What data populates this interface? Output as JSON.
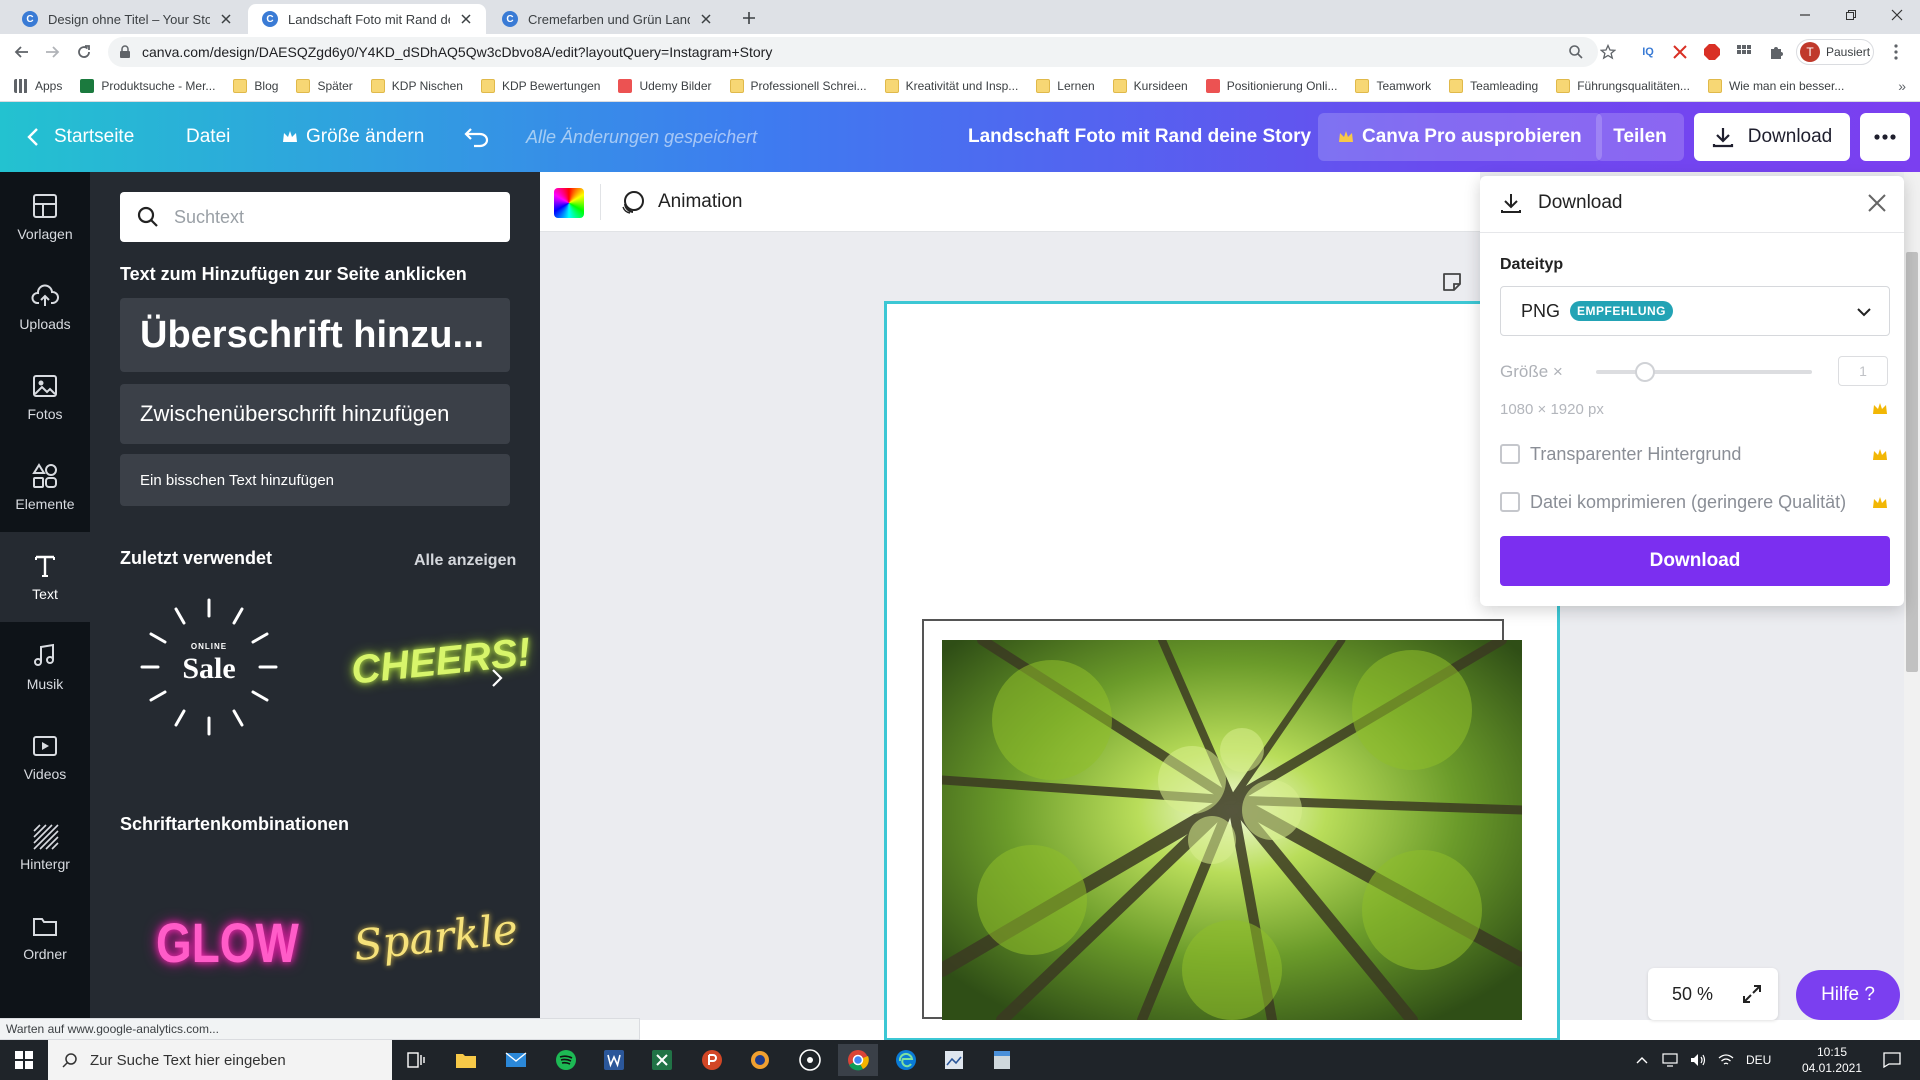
{
  "browser": {
    "tabs": [
      {
        "label": "Design ohne Titel – Your Story"
      },
      {
        "label": "Landschaft Foto mit Rand deine"
      },
      {
        "label": "Cremefarben und Grün Landkarte"
      }
    ],
    "url": "canva.com/design/DAESQZgd6y0/Y4KD_dSDhAQ5Qw3cDbvo8A/edit?layoutQuery=Instagram+Story",
    "profile_label": "Pausiert",
    "profile_initial": "T",
    "bookmarks": [
      {
        "label": "Apps",
        "icon": "apps-grid-icon"
      },
      {
        "label": "Produktsuche - Mer...",
        "icon": "merch-icon"
      },
      {
        "label": "Blog",
        "icon": "folder-icon"
      },
      {
        "label": "Später",
        "icon": "folder-icon"
      },
      {
        "label": "KDP Nischen",
        "icon": "folder-icon"
      },
      {
        "label": "KDP Bewertungen",
        "icon": "folder-icon"
      },
      {
        "label": "Udemy Bilder",
        "icon": "udemy-icon"
      },
      {
        "label": "Professionell Schrei...",
        "icon": "folder-icon"
      },
      {
        "label": "Kreativität und Insp...",
        "icon": "folder-icon"
      },
      {
        "label": "Lernen",
        "icon": "folder-icon"
      },
      {
        "label": "Kursideen",
        "icon": "folder-icon"
      },
      {
        "label": "Positionierung Onli...",
        "icon": "udemy-icon"
      },
      {
        "label": "Teamwork",
        "icon": "folder-icon"
      },
      {
        "label": "Teamleading",
        "icon": "folder-icon"
      },
      {
        "label": "Führungsqualitäten...",
        "icon": "folder-icon"
      },
      {
        "label": "Wie man ein besser...",
        "icon": "folder-icon"
      }
    ],
    "status_text": "Warten auf www.google-analytics.com..."
  },
  "header": {
    "home": "Startseite",
    "file": "Datei",
    "resize": "Größe ändern",
    "saved": "Alle Änderungen gespeichert",
    "title": "Landschaft Foto mit Rand deine Story",
    "pro": "Canva Pro ausprobieren",
    "share": "Teilen",
    "download": "Download"
  },
  "rail": [
    {
      "label": "Vorlagen",
      "icon": "templates-icon"
    },
    {
      "label": "Uploads",
      "icon": "upload-cloud-icon"
    },
    {
      "label": "Fotos",
      "icon": "photo-icon"
    },
    {
      "label": "Elemente",
      "icon": "elements-icon"
    },
    {
      "label": "Text",
      "icon": "text-icon"
    },
    {
      "label": "Musik",
      "icon": "music-icon"
    },
    {
      "label": "Videos",
      "icon": "video-icon"
    },
    {
      "label": "Hintergr",
      "icon": "background-icon"
    },
    {
      "label": "Ordner",
      "icon": "folder-icon"
    }
  ],
  "panel": {
    "search_placeholder": "Suchtext",
    "click_hint": "Text zum Hinzufügen zur Seite anklicken",
    "heading": "Überschrift hinzu...",
    "subheading": "Zwischenüberschrift hinzufügen",
    "body": "Ein bisschen Text hinzufügen",
    "recent": "Zuletzt verwendet",
    "show_all": "Alle anzeigen",
    "combos": "Schriftartenkombinationen",
    "samples": {
      "sale_top": "ONLINE",
      "sale": "Sale",
      "cheers": "CHEERS!",
      "glow": "GLOW",
      "sparkle": "Sparkle"
    }
  },
  "editor": {
    "animation": "Animation",
    "zoom": "50 %",
    "help": "Hilfe ?"
  },
  "download_panel": {
    "title": "Download",
    "filetype_label": "Dateityp",
    "filetype": "PNG",
    "badge": "EMPFEHLUNG",
    "size_label": "Größe ×",
    "size_value": "1",
    "size_fraction": 0.2,
    "dimensions": "1080 × 1920 px",
    "transparent": "Transparenter Hintergrund",
    "compress": "Datei komprimieren (geringere Qualität)",
    "button": "Download"
  },
  "taskbar": {
    "search_placeholder": "Zur Suche Text hier eingeben",
    "lang": "DEU",
    "time": "10:15",
    "date": "04.01.2021"
  },
  "colors": {
    "accent_purple": "#7b2ff0",
    "page_border": "#3cc7d4",
    "badge": "#23a3b5"
  }
}
